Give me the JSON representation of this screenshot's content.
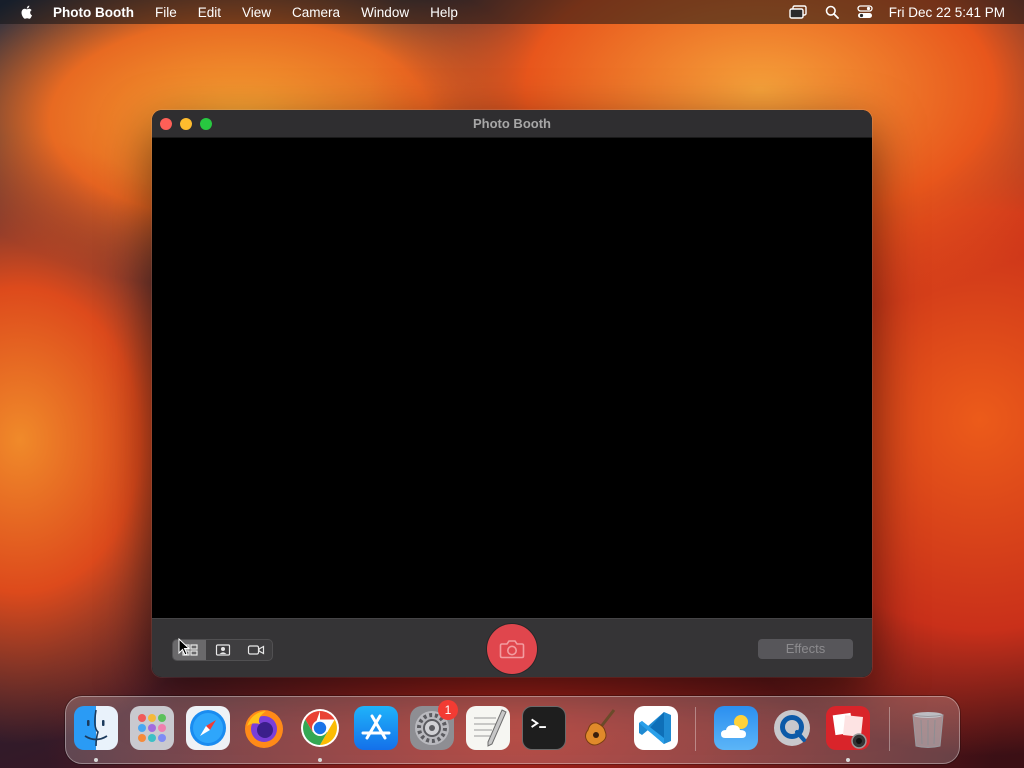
{
  "menubar": {
    "app_name": "Photo Booth",
    "menus": [
      "File",
      "Edit",
      "View",
      "Camera",
      "Window",
      "Help"
    ],
    "clock": "Fri Dec 22  5:41 PM"
  },
  "window": {
    "title": "Photo Booth",
    "effects_label": "Effects",
    "modes": [
      "four-up-photo-mode",
      "single-photo-mode",
      "video-mode"
    ],
    "active_mode": "four-up-photo-mode"
  },
  "dock": {
    "apps": [
      "Finder",
      "Launchpad",
      "Safari",
      "Firefox",
      "Google Chrome",
      "App Store",
      "System Settings",
      "TextEdit",
      "Terminal",
      "GarageBand",
      "Visual Studio Code",
      "Weather",
      "QuickTime Player",
      "Photo Booth",
      "Trash"
    ],
    "system_settings_badge": "1"
  },
  "colors": {
    "shutter": "#e0464d",
    "traffic_red": "#fe5f57",
    "traffic_yellow": "#febc2e",
    "traffic_green": "#28c840"
  }
}
